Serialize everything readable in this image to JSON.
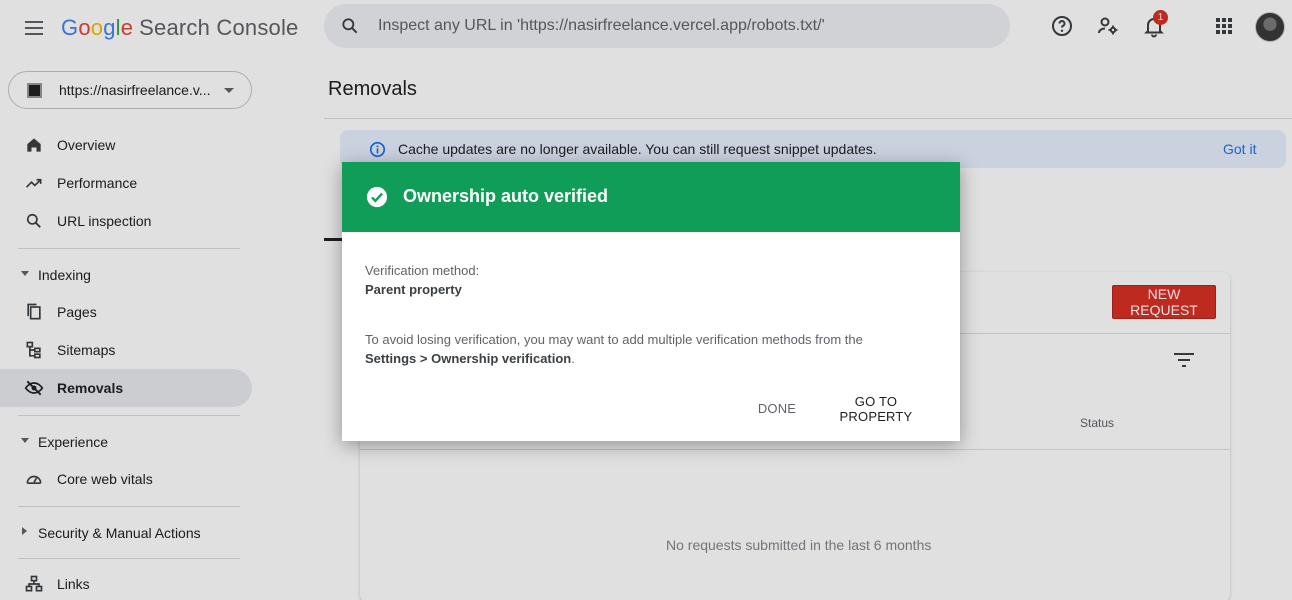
{
  "app": {
    "logo_letters": [
      "G",
      "o",
      "o",
      "g",
      "l",
      "e"
    ],
    "product": "Search Console"
  },
  "search": {
    "placeholder": "Inspect any URL in 'https://nasirfreelance.vercel.app/robots.txt/'"
  },
  "notifications": {
    "count": "1"
  },
  "icons": {
    "menu": "hamburger-menu-icon",
    "search": "search-icon",
    "help": "help-icon",
    "account": "manage-users-icon",
    "notifications": "bell-icon",
    "apps": "apps-grid-icon"
  },
  "sidebar": {
    "property": "https://nasirfreelance.v...",
    "items": [
      {
        "label": "Overview",
        "icon": "home-icon"
      },
      {
        "label": "Performance",
        "icon": "trending-up-icon"
      },
      {
        "label": "URL inspection",
        "icon": "search-icon"
      }
    ],
    "sections": [
      {
        "label": "Indexing",
        "items": [
          {
            "label": "Pages",
            "icon": "pages-icon"
          },
          {
            "label": "Sitemaps",
            "icon": "sitemap-icon"
          },
          {
            "label": "Removals",
            "icon": "eye-off-icon",
            "active": true
          }
        ]
      },
      {
        "label": "Experience",
        "items": [
          {
            "label": "Core web vitals",
            "icon": "speedometer-icon"
          }
        ]
      },
      {
        "label": "Security & Manual Actions",
        "items": []
      }
    ],
    "links": {
      "label": "Links",
      "icon": "links-icon"
    }
  },
  "main": {
    "title": "Removals",
    "info_bar": {
      "text": "Cache updates are no longer available. You can still request snippet updates.",
      "action": "Got it"
    },
    "card": {
      "new_request": "NEW REQUEST",
      "status_header": "Status",
      "empty_text": "No requests submitted in the last 6 months"
    }
  },
  "dialog": {
    "title": "Ownership auto verified",
    "method_label": "Verification method:",
    "method_value": "Parent property",
    "body": "To avoid losing verification, you may want to add multiple verification methods from the",
    "path_bold": "Settings > Ownership verification",
    "path_suffix": ".",
    "done": "DONE",
    "go": "GO TO PROPERTY",
    "header_color": "#0f9d58"
  },
  "colors": {
    "accent_blue": "#1a73e8",
    "danger_red": "#d93025",
    "success_green": "#0f9d58"
  }
}
